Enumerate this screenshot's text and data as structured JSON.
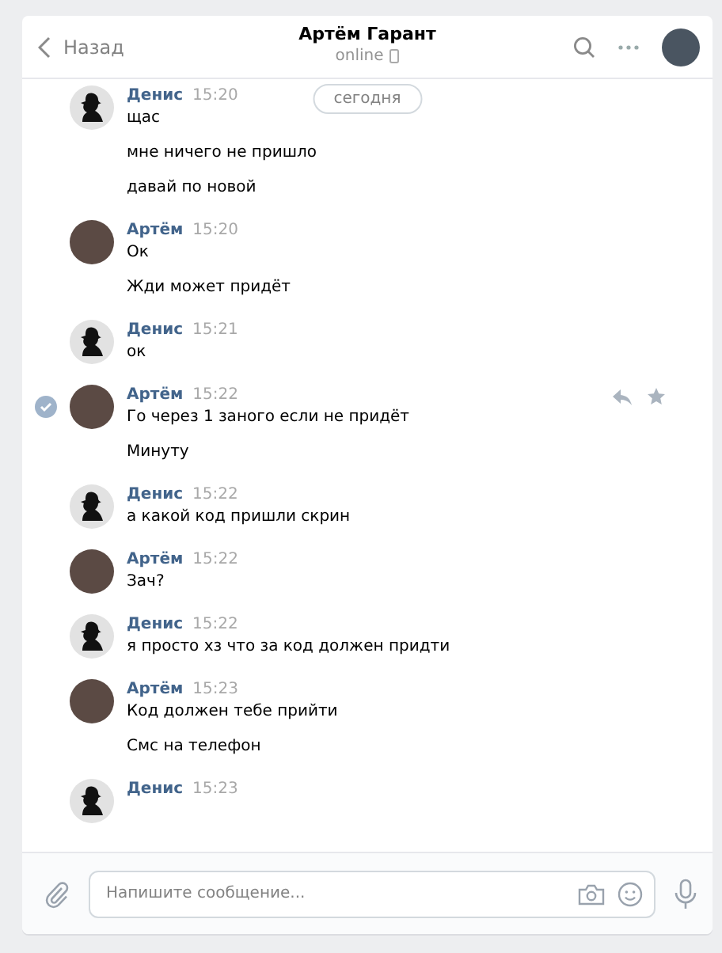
{
  "header": {
    "back_label": "Назад",
    "title": "Артём Гарант",
    "status": "online"
  },
  "date_pill": "сегодня",
  "messages": [
    {
      "author": "Денис",
      "time": "15:20",
      "kind": "silhouette",
      "selected": false,
      "lines": [
        "щас",
        "мне ничего не пришло",
        "давай по новой"
      ]
    },
    {
      "author": "Артём",
      "time": "15:20",
      "kind": "photo",
      "selected": false,
      "lines": [
        "Ок",
        "Жди может придёт"
      ]
    },
    {
      "author": "Денис",
      "time": "15:21",
      "kind": "silhouette",
      "selected": false,
      "lines": [
        "ок"
      ]
    },
    {
      "author": "Артём",
      "time": "15:22",
      "kind": "photo",
      "selected": true,
      "lines": [
        "Го через 1 заного если не придёт",
        "Минуту"
      ]
    },
    {
      "author": "Денис",
      "time": "15:22",
      "kind": "silhouette",
      "selected": false,
      "lines": [
        "а какой код пришли скрин"
      ]
    },
    {
      "author": "Артём",
      "time": "15:22",
      "kind": "photo",
      "selected": false,
      "lines": [
        "Зач?"
      ]
    },
    {
      "author": "Денис",
      "time": "15:22",
      "kind": "silhouette",
      "selected": false,
      "lines": [
        "я просто хз что за код должен придти"
      ]
    },
    {
      "author": "Артём",
      "time": "15:23",
      "kind": "photo",
      "selected": false,
      "lines": [
        "Код должен тебе прийти",
        "Смс на телефон"
      ]
    },
    {
      "author": "Денис",
      "time": "15:23",
      "kind": "silhouette",
      "selected": false
    }
  ],
  "composer": {
    "placeholder": "Напишите сообщение..."
  }
}
